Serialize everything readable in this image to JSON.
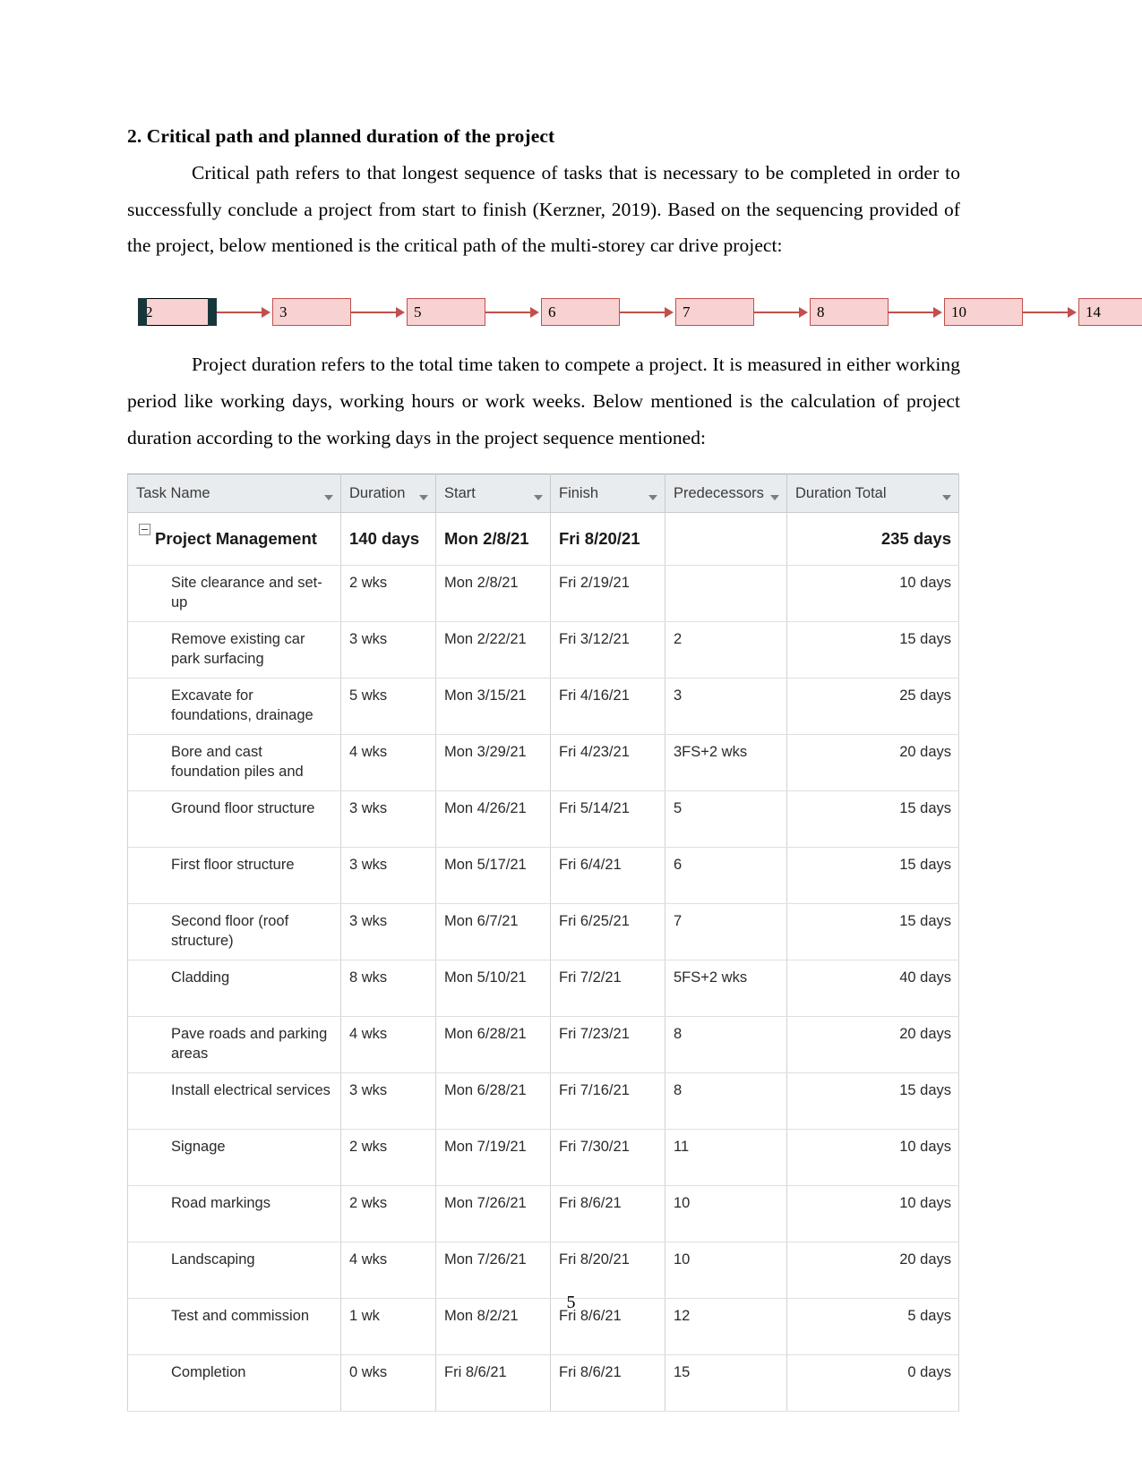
{
  "document": {
    "heading": "2. Critical path and planned duration of the project",
    "paragraph_1": "Critical path refers to that longest sequence of tasks that is necessary to be completed in order to successfully conclude a project from start to finish (Kerzner, 2019). Based on the sequencing provided of the project, below mentioned is the critical path of the multi-storey car drive project:",
    "paragraph_2": "Project duration refers to the total time taken to compete a project. It is measured in either working period like working days, working hours or work weeks. Below mentioned is the calculation of project duration according to the working days in the project sequence mentioned:",
    "page_number": "5"
  },
  "critical_path": {
    "node_fill": "#f8d2d2",
    "node_border": "#c0504d",
    "arrow_color": "#c0504d",
    "selected_handle_color": "#17373a",
    "nodes": [
      {
        "label": "2",
        "selected": true
      },
      {
        "label": "3",
        "selected": false
      },
      {
        "label": "5",
        "selected": false
      },
      {
        "label": "6",
        "selected": false
      },
      {
        "label": "7",
        "selected": false
      },
      {
        "label": "8",
        "selected": false
      },
      {
        "label": "10",
        "selected": false
      },
      {
        "label": "14",
        "selected": false
      }
    ]
  },
  "project_table": {
    "columns": [
      {
        "label": "Task Name",
        "filter": true
      },
      {
        "label": "Duration",
        "filter": true
      },
      {
        "label": "Start",
        "filter": true
      },
      {
        "label": "Finish",
        "filter": true
      },
      {
        "label": "Predecessors",
        "filter": true
      },
      {
        "label": "Duration Total",
        "filter": true
      }
    ],
    "rows": [
      {
        "summary": true,
        "task": "Project Management",
        "duration": "140 days",
        "start": "Mon 2/8/21",
        "finish": "Fri 8/20/21",
        "predecessors": "",
        "duration_total": "235 days"
      },
      {
        "summary": false,
        "task": "Site clearance and set-up",
        "duration": "2 wks",
        "start": "Mon 2/8/21",
        "finish": "Fri 2/19/21",
        "predecessors": "",
        "duration_total": "10 days"
      },
      {
        "summary": false,
        "task": "Remove existing car park surfacing",
        "duration": "3 wks",
        "start": "Mon 2/22/21",
        "finish": "Fri 3/12/21",
        "predecessors": "2",
        "duration_total": "15 days"
      },
      {
        "summary": false,
        "task": "Excavate for foundations, drainage etc",
        "duration": "5 wks",
        "start": "Mon 3/15/21",
        "finish": "Fri 4/16/21",
        "predecessors": "3",
        "duration_total": "25 days"
      },
      {
        "summary": false,
        "task": "Bore and cast foundation piles and pads",
        "duration": "4 wks",
        "start": "Mon 3/29/21",
        "finish": "Fri 4/23/21",
        "predecessors": "3FS+2 wks",
        "duration_total": "20 days"
      },
      {
        "summary": false,
        "task": "Ground floor structure",
        "duration": "3 wks",
        "start": "Mon 4/26/21",
        "finish": "Fri 5/14/21",
        "predecessors": "5",
        "duration_total": "15 days"
      },
      {
        "summary": false,
        "task": "First floor structure",
        "duration": "3 wks",
        "start": "Mon 5/17/21",
        "finish": "Fri 6/4/21",
        "predecessors": "6",
        "duration_total": "15 days"
      },
      {
        "summary": false,
        "task": "Second floor (roof structure)",
        "duration": "3 wks",
        "start": "Mon 6/7/21",
        "finish": "Fri 6/25/21",
        "predecessors": "7",
        "duration_total": "15 days"
      },
      {
        "summary": false,
        "task": "Cladding",
        "duration": "8 wks",
        "start": "Mon 5/10/21",
        "finish": "Fri 7/2/21",
        "predecessors": "5FS+2 wks",
        "duration_total": "40 days"
      },
      {
        "summary": false,
        "task": "Pave roads and parking areas",
        "duration": "4 wks",
        "start": "Mon 6/28/21",
        "finish": "Fri 7/23/21",
        "predecessors": "8",
        "duration_total": "20 days"
      },
      {
        "summary": false,
        "task": "Install electrical services",
        "duration": "3 wks",
        "start": "Mon 6/28/21",
        "finish": "Fri 7/16/21",
        "predecessors": "8",
        "duration_total": "15 days"
      },
      {
        "summary": false,
        "task": "Signage",
        "duration": "2 wks",
        "start": "Mon 7/19/21",
        "finish": "Fri 7/30/21",
        "predecessors": "11",
        "duration_total": "10 days"
      },
      {
        "summary": false,
        "task": "Road markings",
        "duration": "2 wks",
        "start": "Mon 7/26/21",
        "finish": "Fri 8/6/21",
        "predecessors": "10",
        "duration_total": "10 days"
      },
      {
        "summary": false,
        "task": "Landscaping",
        "duration": "4 wks",
        "start": "Mon 7/26/21",
        "finish": "Fri 8/20/21",
        "predecessors": "10",
        "duration_total": "20 days"
      },
      {
        "summary": false,
        "task": "Test and commission",
        "duration": "1 wk",
        "start": "Mon 8/2/21",
        "finish": "Fri 8/6/21",
        "predecessors": "12",
        "duration_total": "5 days"
      },
      {
        "summary": false,
        "task": "Completion",
        "duration": "0 wks",
        "start": "Fri 8/6/21",
        "finish": "Fri 8/6/21",
        "predecessors": "15",
        "duration_total": "0 days"
      }
    ]
  }
}
